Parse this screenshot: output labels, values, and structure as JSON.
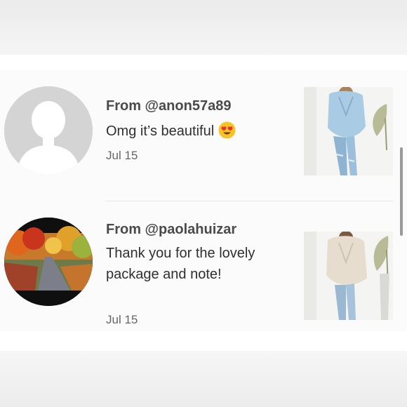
{
  "reviews": [
    {
      "from": "From @anon57a89",
      "message": "Omg it’s beautiful",
      "emoji_icon": "heart-eyes-emoji-icon",
      "date": "Jul 15",
      "avatar": "default-person-avatar",
      "thumbnail": "light-blue-draped-top-photo"
    },
    {
      "from": "From @paolahuizar",
      "message": "Thank you for the lovely package and note!",
      "date": "Jul 15",
      "avatar": "autumn-road-photo-avatar",
      "thumbnail": "cream-draped-top-photo"
    }
  ],
  "colors": {
    "text_primary": "#2f2f2f",
    "text_secondary": "#666666",
    "divider": "#e8e8e8",
    "emoji": "#f7c325",
    "heart": "#e8303d"
  }
}
